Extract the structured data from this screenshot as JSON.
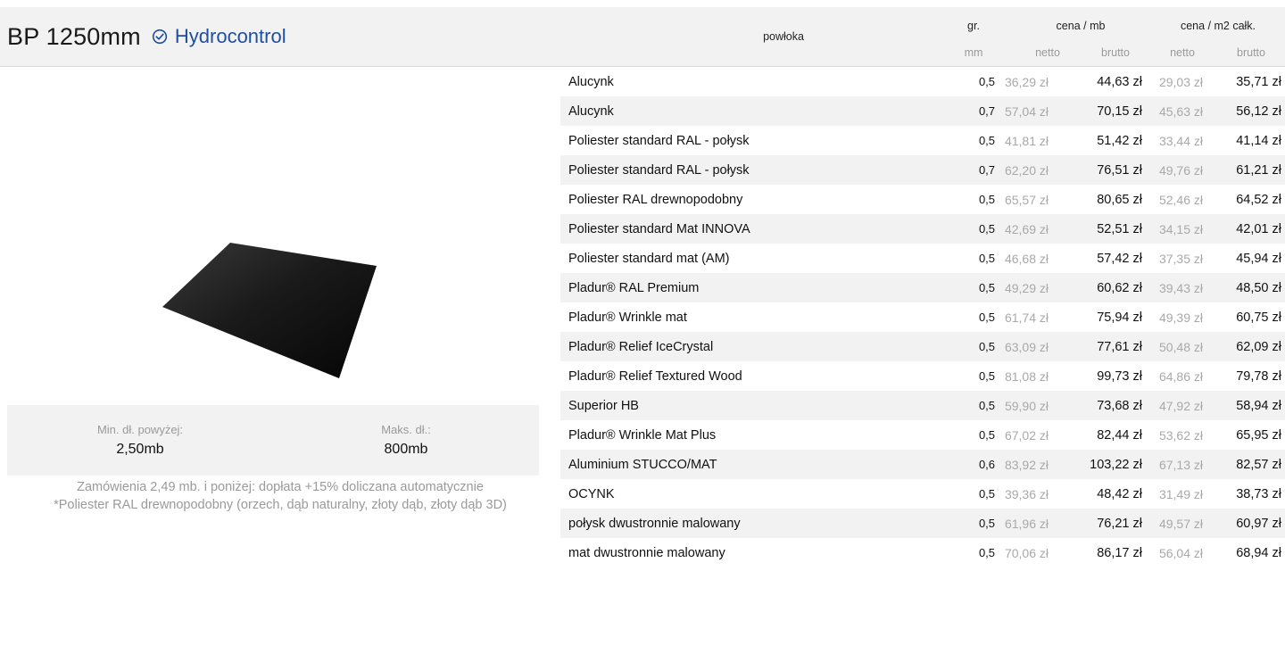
{
  "product": {
    "name": "BP 1250mm",
    "badge": "Hydrocontrol"
  },
  "lengths": {
    "min_label": "Min. dł. powyżej:",
    "min_value": "2,50mb",
    "max_label": "Maks. dł.:",
    "max_value": "800mb"
  },
  "notes": [
    "Zamówienia 2,49 mb. i poniżej: dopłata +15% doliczana automatycznie",
    "*Poliester RAL drewnopodobny (orzech, dąb naturalny, złoty dąb, złoty dąb 3D)"
  ],
  "table": {
    "headers": {
      "coating": "powłoka",
      "thickness": "gr.",
      "thickness_unit": "mm",
      "price_mb": "cena / mb",
      "price_m2": "cena / m2 całk.",
      "net": "netto",
      "gross": "brutto"
    },
    "rows": [
      {
        "name": "Alucynk",
        "mm": "0,5",
        "mb_net": "36,29 zł",
        "mb_gross": "44,63 zł",
        "m2_net": "29,03 zł",
        "m2_gross": "35,71 zł"
      },
      {
        "name": "Alucynk",
        "mm": "0,7",
        "mb_net": "57,04 zł",
        "mb_gross": "70,15 zł",
        "m2_net": "45,63 zł",
        "m2_gross": "56,12 zł"
      },
      {
        "name": "Poliester standard RAL - połysk",
        "mm": "0,5",
        "mb_net": "41,81 zł",
        "mb_gross": "51,42 zł",
        "m2_net": "33,44 zł",
        "m2_gross": "41,14 zł"
      },
      {
        "name": "Poliester standard RAL - połysk",
        "mm": "0,7",
        "mb_net": "62,20 zł",
        "mb_gross": "76,51 zł",
        "m2_net": "49,76 zł",
        "m2_gross": "61,21 zł"
      },
      {
        "name": "Poliester RAL drewnopodobny",
        "mm": "0,5",
        "mb_net": "65,57 zł",
        "mb_gross": "80,65 zł",
        "m2_net": "52,46 zł",
        "m2_gross": "64,52 zł"
      },
      {
        "name": "Poliester standard Mat INNOVA",
        "mm": "0,5",
        "mb_net": "42,69 zł",
        "mb_gross": "52,51 zł",
        "m2_net": "34,15 zł",
        "m2_gross": "42,01 zł"
      },
      {
        "name": "Poliester standard mat (AM)",
        "mm": "0,5",
        "mb_net": "46,68 zł",
        "mb_gross": "57,42 zł",
        "m2_net": "37,35 zł",
        "m2_gross": "45,94 zł"
      },
      {
        "name": "Pladur® RAL Premium",
        "mm": "0,5",
        "mb_net": "49,29 zł",
        "mb_gross": "60,62 zł",
        "m2_net": "39,43 zł",
        "m2_gross": "48,50 zł"
      },
      {
        "name": "Pladur® Wrinkle mat",
        "mm": "0,5",
        "mb_net": "61,74 zł",
        "mb_gross": "75,94 zł",
        "m2_net": "49,39 zł",
        "m2_gross": "60,75 zł"
      },
      {
        "name": "Pladur® Relief IceCrystal",
        "mm": "0,5",
        "mb_net": "63,09 zł",
        "mb_gross": "77,61 zł",
        "m2_net": "50,48 zł",
        "m2_gross": "62,09 zł"
      },
      {
        "name": "Pladur® Relief Textured Wood",
        "mm": "0,5",
        "mb_net": "81,08 zł",
        "mb_gross": "99,73 zł",
        "m2_net": "64,86 zł",
        "m2_gross": "79,78 zł"
      },
      {
        "name": "Superior HB",
        "mm": "0,5",
        "mb_net": "59,90 zł",
        "mb_gross": "73,68 zł",
        "m2_net": "47,92 zł",
        "m2_gross": "58,94 zł"
      },
      {
        "name": "Pladur® Wrinkle Mat Plus",
        "mm": "0,5",
        "mb_net": "67,02 zł",
        "mb_gross": "82,44 zł",
        "m2_net": "53,62 zł",
        "m2_gross": "65,95 zł"
      },
      {
        "name": "Aluminium STUCCO/MAT",
        "mm": "0,6",
        "mb_net": "83,92 zł",
        "mb_gross": "103,22 zł",
        "m2_net": "67,13 zł",
        "m2_gross": "82,57 zł"
      },
      {
        "name": "OCYNK",
        "mm": "0,5",
        "mb_net": "39,36 zł",
        "mb_gross": "48,42 zł",
        "m2_net": "31,49 zł",
        "m2_gross": "38,73 zł"
      },
      {
        "name": "połysk dwustronnie malowany",
        "mm": "0,5",
        "mb_net": "61,96 zł",
        "mb_gross": "76,21 zł",
        "m2_net": "49,57 zł",
        "m2_gross": "60,97 zł"
      },
      {
        "name": "mat dwustronnie malowany",
        "mm": "0,5",
        "mb_net": "70,06 zł",
        "mb_gross": "86,17 zł",
        "m2_net": "56,04 zł",
        "m2_gross": "68,94 zł"
      }
    ]
  },
  "colors": {
    "accent": "#1f4fa0",
    "panel_bg": "#f2f2f2",
    "muted_text": "#9a9a9a"
  },
  "icons": {
    "badge": "check-circle-icon"
  }
}
